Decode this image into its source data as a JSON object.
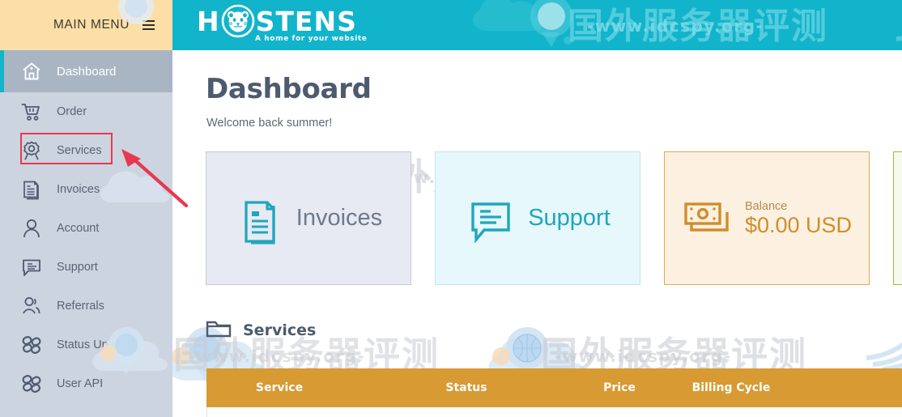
{
  "sidebar": {
    "header": {
      "title": "MAIN MENU",
      "menu_icon": "hamburger-icon"
    },
    "items": [
      {
        "label": "Dashboard",
        "icon": "home-icon",
        "active": true
      },
      {
        "label": "Order",
        "icon": "cart-icon",
        "active": false
      },
      {
        "label": "Services",
        "icon": "gear-icon",
        "active": false
      },
      {
        "label": "Invoices",
        "icon": "document-icon",
        "active": false
      },
      {
        "label": "Account",
        "icon": "user-icon",
        "active": false
      },
      {
        "label": "Support",
        "icon": "chat-icon",
        "active": false
      },
      {
        "label": "Referrals",
        "icon": "users-icon",
        "active": false
      },
      {
        "label": "Status Updates",
        "icon": "link-icon",
        "active": false
      },
      {
        "label": "User API",
        "icon": "link-icon",
        "active": false
      }
    ]
  },
  "header": {
    "logo_left": "H",
    "logo_right": "STENS",
    "logo_mark": "hamster-logo-icon",
    "tagline": "A home for your website",
    "background": "#11b4cb"
  },
  "main": {
    "title": "Dashboard",
    "subtitle": "Welcome back summer!",
    "cards": [
      {
        "id": "invoices",
        "label": "Invoices",
        "icon": "invoice-document-icon",
        "bg": "#e7eaf2",
        "border": "#c4c9d4",
        "text_color": "#6e7a8c"
      },
      {
        "id": "support",
        "label": "Support",
        "icon": "speech-bubble-icon",
        "bg": "#e6f8fb",
        "border": "#bfe6ee",
        "text_color": "#1fa6bd"
      },
      {
        "id": "balance",
        "label": "Balance",
        "amount": "$0.00 USD",
        "icon": "banknote-icon",
        "bg": "#fcf1e1",
        "border": "#e0a852",
        "text_color": "#d08d2c"
      },
      {
        "id": "extra",
        "label": "",
        "icon": "",
        "bg": "#f6faec",
        "border": "#9bb84a",
        "text_color": "#7a9a30"
      }
    ],
    "services_section": {
      "heading": "Services",
      "heading_icon": "folder-icon",
      "table": {
        "header_bg": "#d89a33",
        "columns": [
          "Service",
          "Status",
          "Price",
          "Billing Cycle"
        ],
        "rows": []
      }
    }
  },
  "annotations": {
    "highlight_box": {
      "target": "Services",
      "color": "#e8384f"
    },
    "arrow": {
      "color": "#e8384f",
      "points_to": "Services"
    }
  },
  "watermarks": {
    "cn_text": "国外服务器评测",
    "url_text": "-www.idcspy.org-"
  }
}
